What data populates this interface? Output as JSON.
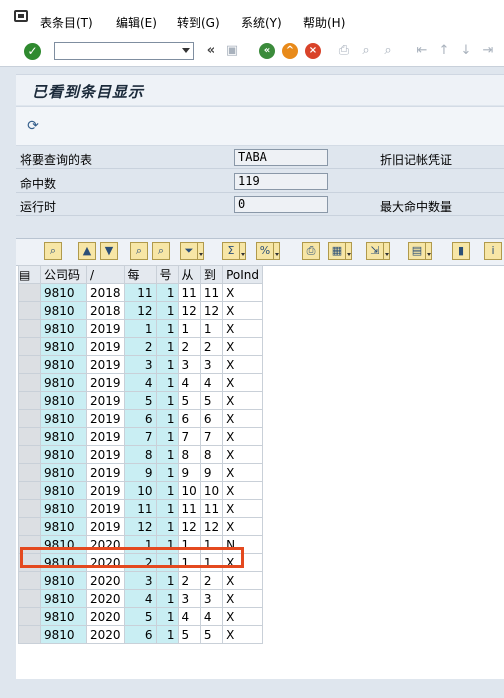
{
  "menu": {
    "items": [
      "表条目(T)",
      "编辑(E)",
      "转到(G)",
      "系统(Y)",
      "帮助(H)"
    ]
  },
  "toolbar": {
    "command_value": "",
    "back_symbol": "«"
  },
  "page": {
    "title": "已看到条目显示"
  },
  "form": {
    "table_label": "将要查询的表",
    "table_value": "TABA",
    "table_desc": "折旧记帐凭证",
    "hits_label": "命中数",
    "hits_value": "119",
    "runtime_label": "运行时",
    "runtime_value": "0",
    "max_hits_label": "最大命中数量"
  },
  "grid": {
    "columns": [
      "公司码",
      "/",
      "每",
      "号",
      "从",
      "到",
      "PoInd"
    ],
    "rows": [
      [
        "9810",
        "2018",
        "11",
        "1",
        "11",
        "11",
        "X"
      ],
      [
        "9810",
        "2018",
        "12",
        "1",
        "12",
        "12",
        "X"
      ],
      [
        "9810",
        "2019",
        "1",
        "1",
        "1",
        "1",
        "X"
      ],
      [
        "9810",
        "2019",
        "2",
        "1",
        "2",
        "2",
        "X"
      ],
      [
        "9810",
        "2019",
        "3",
        "1",
        "3",
        "3",
        "X"
      ],
      [
        "9810",
        "2019",
        "4",
        "1",
        "4",
        "4",
        "X"
      ],
      [
        "9810",
        "2019",
        "5",
        "1",
        "5",
        "5",
        "X"
      ],
      [
        "9810",
        "2019",
        "6",
        "1",
        "6",
        "6",
        "X"
      ],
      [
        "9810",
        "2019",
        "7",
        "1",
        "7",
        "7",
        "X"
      ],
      [
        "9810",
        "2019",
        "8",
        "1",
        "8",
        "8",
        "X"
      ],
      [
        "9810",
        "2019",
        "9",
        "1",
        "9",
        "9",
        "X"
      ],
      [
        "9810",
        "2019",
        "10",
        "1",
        "10",
        "10",
        "X"
      ],
      [
        "9810",
        "2019",
        "11",
        "1",
        "11",
        "11",
        "X"
      ],
      [
        "9810",
        "2019",
        "12",
        "1",
        "12",
        "12",
        "X"
      ],
      [
        "9810",
        "2020",
        "1",
        "1",
        "1",
        "1",
        "N"
      ],
      [
        "9810",
        "2020",
        "2",
        "1",
        "1",
        "1",
        "X"
      ],
      [
        "9810",
        "2020",
        "3",
        "1",
        "2",
        "2",
        "X"
      ],
      [
        "9810",
        "2020",
        "4",
        "1",
        "3",
        "3",
        "X"
      ],
      [
        "9810",
        "2020",
        "5",
        "1",
        "4",
        "4",
        "X"
      ],
      [
        "9810",
        "2020",
        "6",
        "1",
        "5",
        "5",
        "X"
      ]
    ],
    "highlighted_row": 14,
    "highlight_color": "#e4491f",
    "key_column_color": "#c9eef3"
  },
  "icons": {
    "ok": "check-icon",
    "save": "save-icon",
    "back": "back-icon",
    "exit": "exit-icon",
    "cancel": "cancel-icon",
    "print": "print-icon",
    "find": "find-icon",
    "refresh": "refresh-icon"
  }
}
